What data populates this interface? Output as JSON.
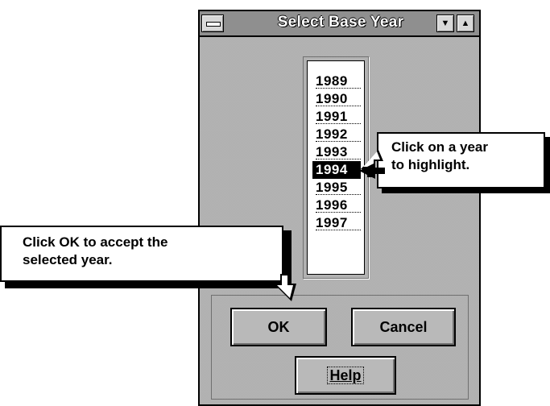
{
  "window": {
    "title": "Select Base Year",
    "titlebar_buttons": [
      "minimize",
      "maximize"
    ]
  },
  "year_list": {
    "items": [
      "1989",
      "1990",
      "1991",
      "1992",
      "1993",
      "1994",
      "1995",
      "1996",
      "1997"
    ],
    "selected": "1994"
  },
  "buttons": {
    "ok_label": "OK",
    "cancel_label": "Cancel",
    "help_label": "Help"
  },
  "callouts": {
    "year_tip": [
      "Click on a year",
      "to highlight."
    ],
    "ok_tip": [
      "Click OK to accept the",
      "selected year."
    ]
  }
}
